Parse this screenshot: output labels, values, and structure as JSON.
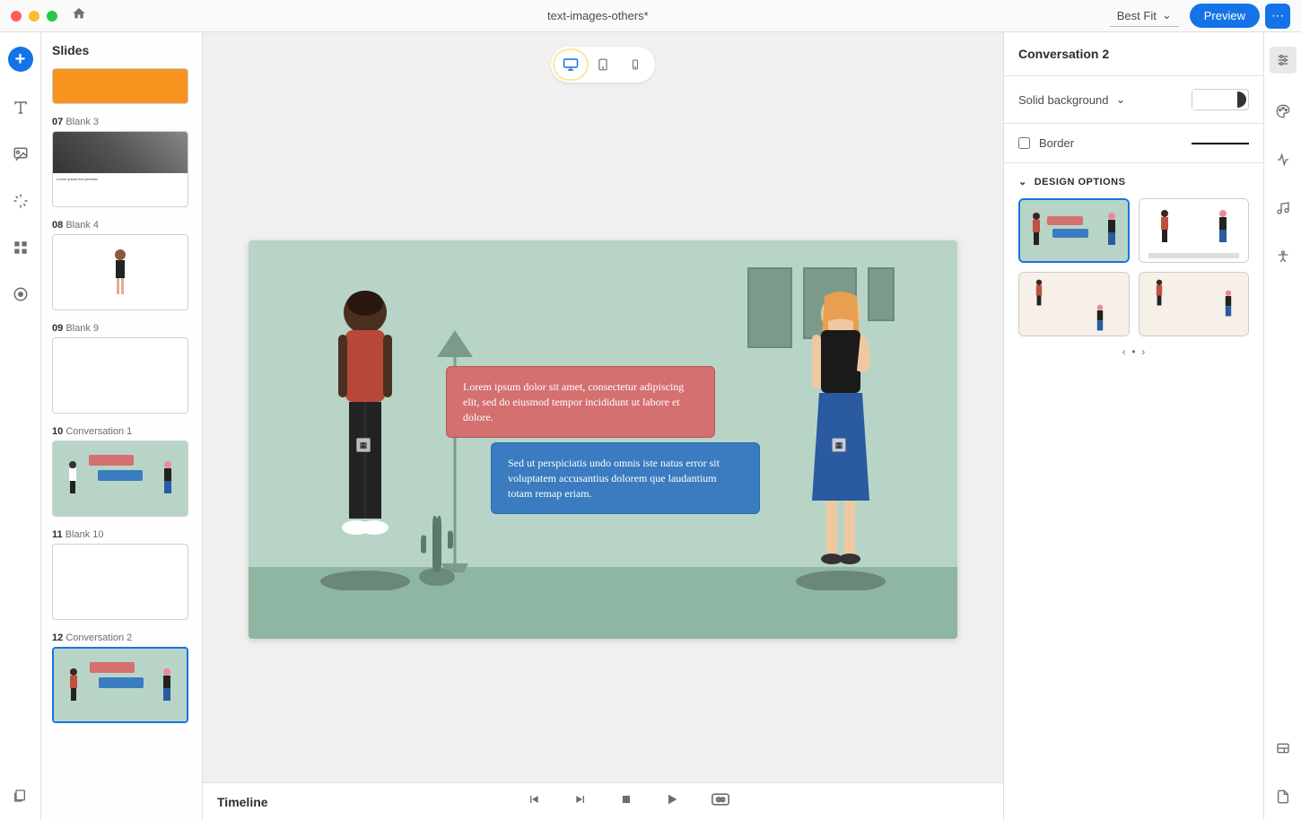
{
  "titlebar": {
    "title": "text-images-others*",
    "fit_label": "Best Fit",
    "preview_label": "Preview"
  },
  "slides_panel": {
    "title": "Slides",
    "items": [
      {
        "num": "",
        "name": "",
        "thumb_type": "orange"
      },
      {
        "num": "07",
        "name": "Blank 3",
        "thumb_type": "desk"
      },
      {
        "num": "08",
        "name": "Blank 4",
        "thumb_type": "person"
      },
      {
        "num": "09",
        "name": "Blank 9",
        "thumb_type": "empty"
      },
      {
        "num": "10",
        "name": "Conversation 1",
        "thumb_type": "convo"
      },
      {
        "num": "11",
        "name": "Blank 10",
        "thumb_type": "empty"
      },
      {
        "num": "12",
        "name": "Conversation 2",
        "thumb_type": "convo",
        "selected": true
      }
    ]
  },
  "canvas": {
    "bubble_red": "Lorem ipsum dolor sit amet, consectetur adipiscing elit, sed do eiusmod tempor incididunt ut labore et dolore.",
    "bubble_blue": "Sed ut perspiciatis undo omnis iste natus error sit voluptatem accusantius dolorem que laudantium totam remap eriam."
  },
  "timeline": {
    "label": "Timeline"
  },
  "properties": {
    "title": "Conversation 2",
    "background_label": "Solid background",
    "border_label": "Border",
    "design_label": "DESIGN OPTIONS"
  },
  "colors": {
    "accent": "#1473e6",
    "bubble_red": "#d47070",
    "bubble_blue": "#3a7cbf",
    "canvas_bg": "#b8d4c7"
  }
}
